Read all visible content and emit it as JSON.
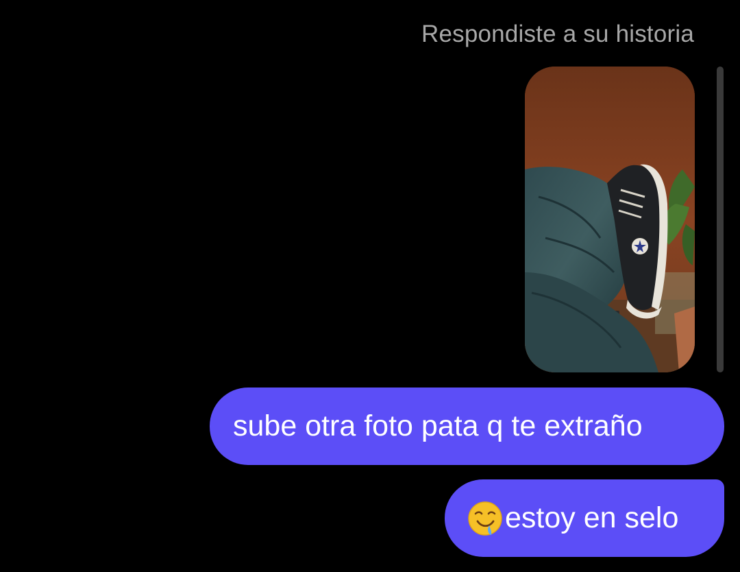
{
  "thread": {
    "story_reply_caption": "Respondiste a su historia",
    "messages": [
      {
        "text": "sube otra foto pata q te extraño"
      },
      {
        "emoji": "drooling-face-emoji",
        "text": "estoy en selo"
      }
    ]
  },
  "colors": {
    "background": "#000000",
    "outgoing_bubble": "#5c4ef7",
    "caption_text": "#a8a8a8",
    "bubble_text": "#ffffff"
  },
  "icons": {
    "story_thumbnail": "sneakers-photo",
    "emoji": "drooling-face-emoji"
  }
}
